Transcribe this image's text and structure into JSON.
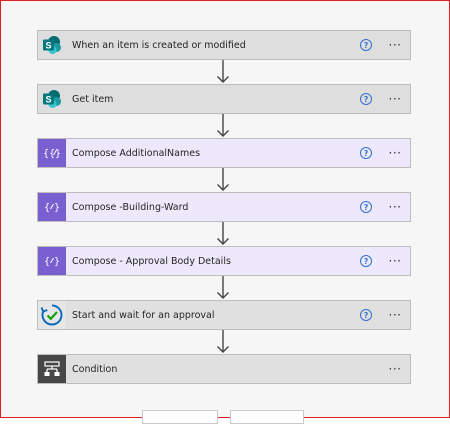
{
  "steps": [
    {
      "label": "When an item is created or modified",
      "icon": "sharepoint-icon",
      "kind": "sp",
      "help": true
    },
    {
      "label": "Get item",
      "icon": "sharepoint-icon",
      "kind": "sp",
      "help": true
    },
    {
      "label": "Compose AdditionalNames",
      "icon": "compose-icon",
      "kind": "comp",
      "help": true
    },
    {
      "label": "Compose -Building-Ward",
      "icon": "compose-icon",
      "kind": "comp",
      "help": true
    },
    {
      "label": "Compose - Approval Body Details",
      "icon": "compose-icon",
      "kind": "comp",
      "help": true
    },
    {
      "label": "Start and wait for an approval",
      "icon": "approval-icon",
      "kind": "appr",
      "help": true
    },
    {
      "label": "Condition",
      "icon": "condition-icon",
      "kind": "cond",
      "help": false
    }
  ],
  "help_glyph": "?",
  "more_glyph": "···",
  "colors": {
    "sharepoint": "#03787c",
    "compose": "#7a5fd1",
    "approval": "#0f6cbd",
    "condition": "#474747",
    "frame_border": "#e02020"
  }
}
